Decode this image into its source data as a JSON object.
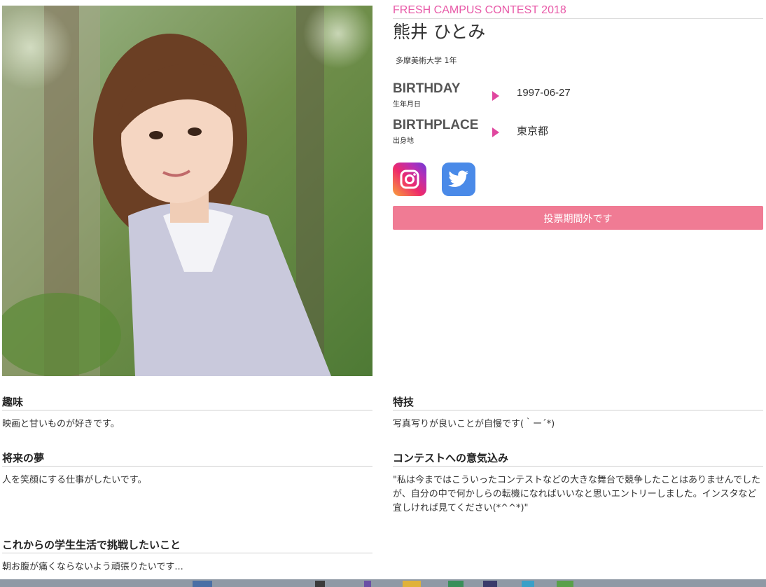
{
  "profile": {
    "contest": "FRESH CAMPUS CONTEST 2018",
    "name": "熊井 ひとみ",
    "school": "多摩美術大学 1年",
    "birthday": {
      "label_en": "BIRTHDAY",
      "label_ja": "生年月日",
      "value": "1997-06-27"
    },
    "birthplace": {
      "label_en": "BIRTHPLACE",
      "label_ja": "出身地",
      "value": "東京都"
    },
    "social": {
      "instagram_icon": "instagram-icon",
      "twitter_icon": "twitter-icon"
    },
    "vote_label": "投票期間外です"
  },
  "sections": {
    "hobby": {
      "title": "趣味",
      "text": "映画と甘いものが好きです。"
    },
    "skill": {
      "title": "特技",
      "text": "写真写りが良いことが自慢です(｀ー´*)"
    },
    "dream": {
      "title": "将来の夢",
      "text": "人を笑顔にする仕事がしたいです。"
    },
    "motivation": {
      "title": "コンテストへの意気込み",
      "text": "\"私は今まではこういったコンテストなどの大きな舞台で競争したことはありませんでしたが、自分の中で何かしらの転機になればいいなと思いエントリーしました。インスタなど宜しければ見てください(*^^*)\""
    },
    "challenge": {
      "title": "これからの学生生活で挑戦したいこと",
      "text": "朝お腹が痛くならないよう頑張りたいです..."
    }
  },
  "colors": {
    "accent_pink": "#e85aa8",
    "arrow_pink": "#e0479f",
    "button_pink": "#f07b94",
    "twitter_blue": "#4a8ae8"
  }
}
